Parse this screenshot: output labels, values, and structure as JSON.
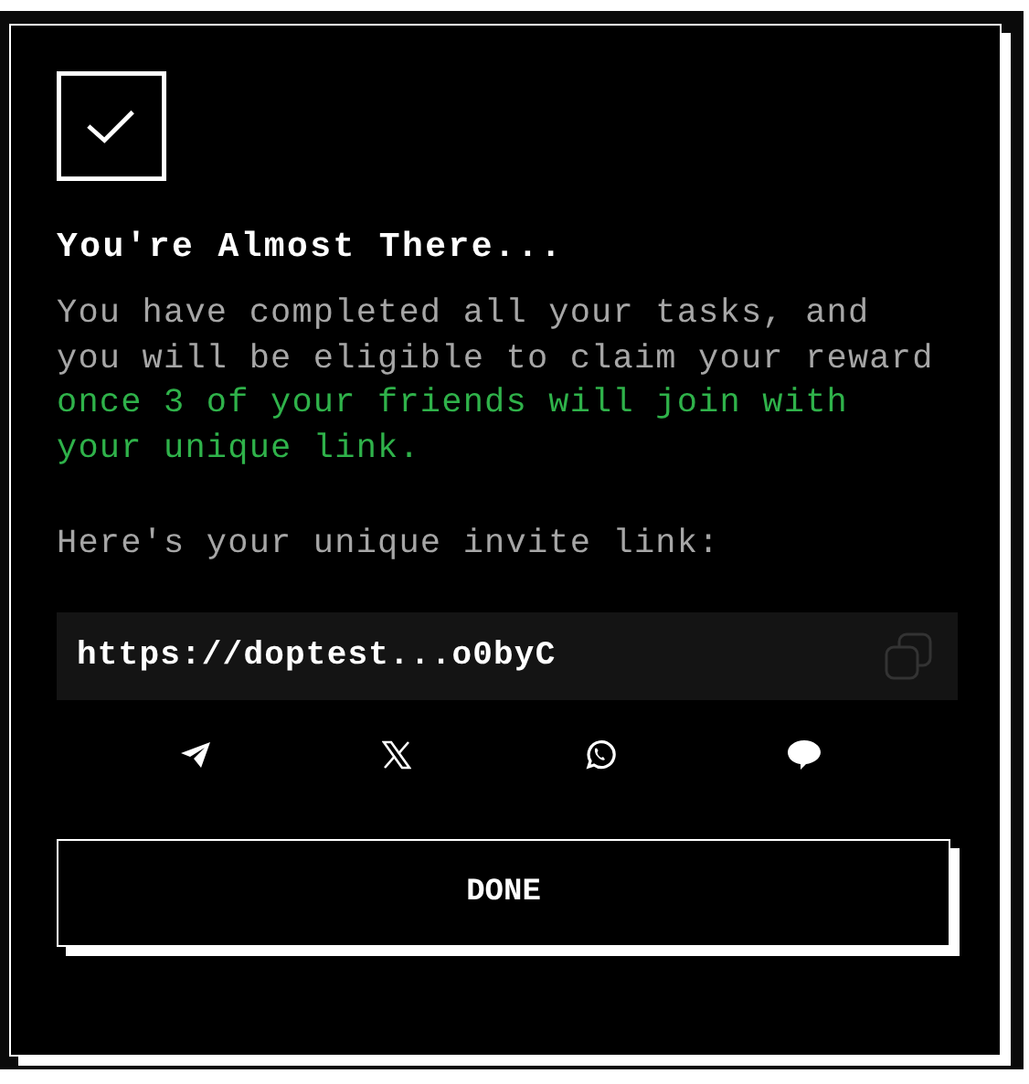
{
  "modal": {
    "title": "You're Almost There...",
    "message": {
      "text": "You have completed all your tasks, and you will be eligible to claim your reward",
      "highlight": "once 3 of your friends will join with your unique link."
    },
    "invite_label": "Here's your unique invite link:",
    "invite_link": "https://doptest...o0byC",
    "share": [
      {
        "kind": "telegram"
      },
      {
        "kind": "x"
      },
      {
        "kind": "whatsapp"
      },
      {
        "kind": "line"
      }
    ],
    "button": "DONE"
  }
}
